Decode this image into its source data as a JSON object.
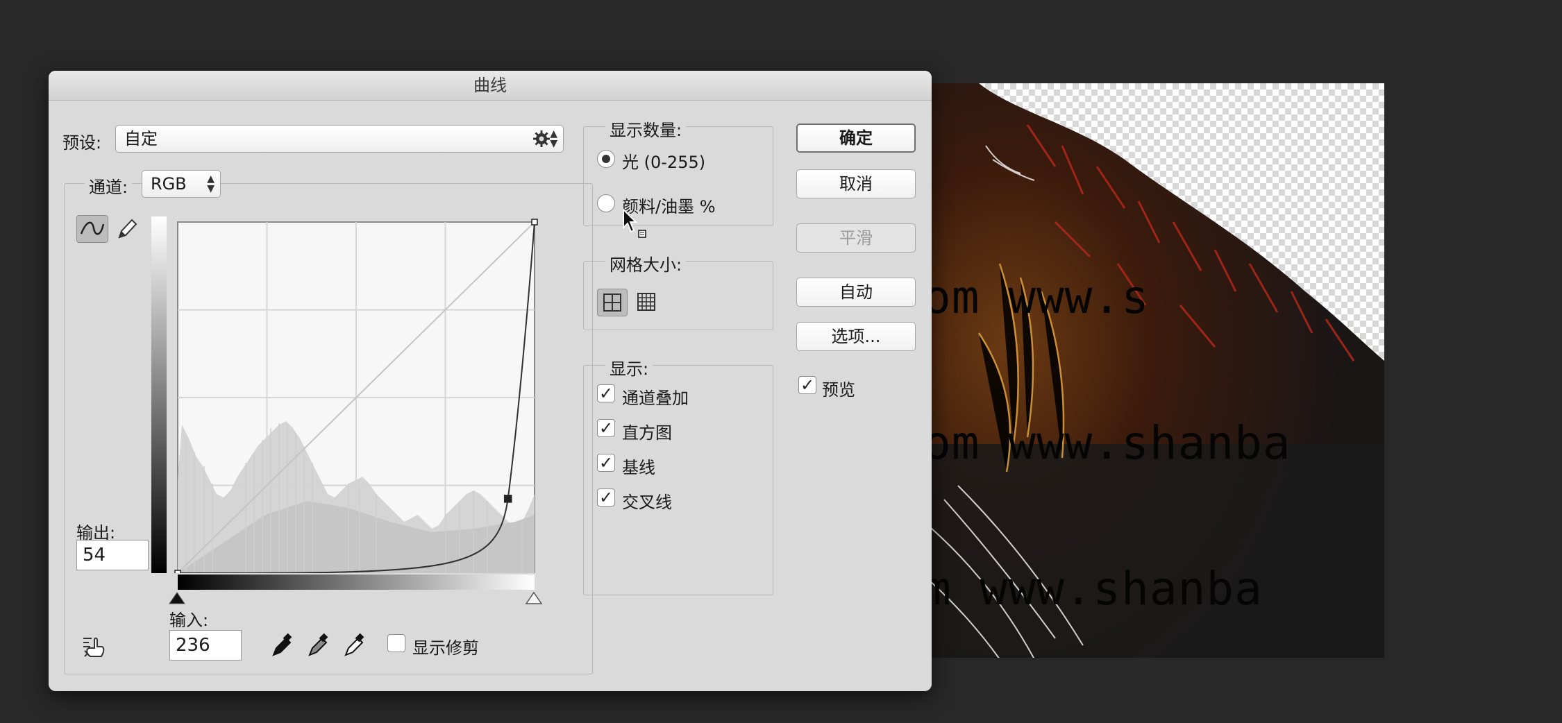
{
  "dialog": {
    "title": "曲线",
    "preset_label": "预设:",
    "preset_value": "自定",
    "channel_label": "通道:",
    "channel_value": "RGB",
    "output_label": "输出:",
    "output_value": "54",
    "input_label": "输入:",
    "input_value": "236",
    "show_clipping_label": "显示修剪",
    "show_clipping_checked": false
  },
  "display_amount": {
    "legend": "显示数量:",
    "options": [
      {
        "label": "光 (0-255)",
        "selected": true
      },
      {
        "label": "颜料/油墨 %",
        "selected": false
      }
    ]
  },
  "grid_size": {
    "legend": "网格大小:",
    "options": [
      "simple-grid-icon",
      "detailed-grid-icon"
    ],
    "selected": "simple-grid-icon"
  },
  "show": {
    "legend": "显示:",
    "options": [
      {
        "label": "通道叠加",
        "checked": true
      },
      {
        "label": "直方图",
        "checked": true
      },
      {
        "label": "基线",
        "checked": true
      },
      {
        "label": "交叉线",
        "checked": true
      }
    ]
  },
  "buttons": {
    "ok": "确定",
    "cancel": "取消",
    "smooth": "平滑",
    "auto": "自动",
    "options": "选项..."
  },
  "preview": {
    "label": "预览",
    "checked": true
  },
  "curve": {
    "points": [
      [
        0,
        0
      ],
      [
        236,
        54
      ],
      [
        255,
        255
      ]
    ]
  },
  "canvas": {
    "watermarks": [
      "om   www.s",
      "om   www.shanba",
      "m    www.shanba"
    ]
  },
  "colors": {
    "dialog_bg": "#dadada",
    "workspace_bg": "#282828"
  }
}
